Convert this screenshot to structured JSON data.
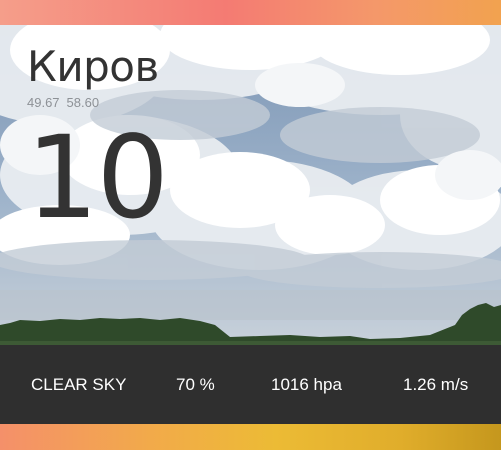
{
  "location": {
    "city": "Киров",
    "lat": "49.67",
    "lon": "58.60"
  },
  "weather": {
    "temperature": "10",
    "description": "CLEAR SKY",
    "humidity": "70 %",
    "pressure": "1016 hpa",
    "wind": "1.26 m/s"
  },
  "theme": {
    "bar_color": "#2f2f2f",
    "text_color": "#333333",
    "gradient_top": [
      "#f59e8a",
      "#f47b73",
      "#f2a24f"
    ],
    "gradient_bottom": [
      "#f4906a",
      "#ecbb35",
      "#c5971d"
    ]
  }
}
